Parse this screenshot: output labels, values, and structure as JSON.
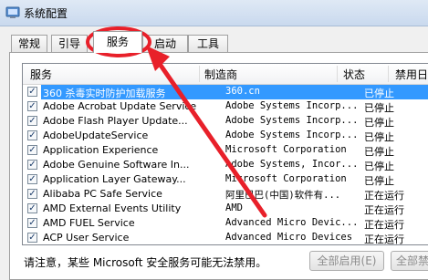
{
  "window": {
    "title": "系统配置"
  },
  "tabs": [
    "常规",
    "引导",
    "服务",
    "启动",
    "工具"
  ],
  "active_tab": "服务",
  "columns": {
    "service": "服务",
    "manufacturer": "制造商",
    "status": "状态",
    "date_disabled": "禁用日"
  },
  "services": [
    {
      "name": "360 杀毒实时防护加载服务",
      "manufacturer": "360.cn",
      "status": "已停止",
      "checked": true,
      "selected": true
    },
    {
      "name": "Adobe Acrobat Update Service",
      "manufacturer": "Adobe Systems Incorp...",
      "status": "已停止",
      "checked": true
    },
    {
      "name": "Adobe Flash Player Update...",
      "manufacturer": "Adobe Systems Incorp...",
      "status": "已停止",
      "checked": true
    },
    {
      "name": "AdobeUpdateService",
      "manufacturer": "Adobe Systems Incorp...",
      "status": "已停止",
      "checked": true
    },
    {
      "name": "Application Experience",
      "manufacturer": "Microsoft Corporation",
      "status": "已停止",
      "checked": true
    },
    {
      "name": "Adobe Genuine Software In...",
      "manufacturer": "Adobe Systems, Incor...",
      "status": "已停止",
      "checked": true
    },
    {
      "name": "Application Layer Gateway...",
      "manufacturer": "Microsoft Corporation",
      "status": "已停止",
      "checked": true
    },
    {
      "name": "Alibaba PC Safe Service",
      "manufacturer": "阿里巴巴(中国)软件有...",
      "status": "正在运行",
      "checked": true
    },
    {
      "name": "AMD External Events Utility",
      "manufacturer": "AMD",
      "status": "正在运行",
      "checked": true
    },
    {
      "name": "AMD FUEL Service",
      "manufacturer": "Advanced Micro Devic...",
      "status": "正在运行",
      "checked": true
    },
    {
      "name": "ACP User Service",
      "manufacturer": "Advanced Micro Devices",
      "status": "正在运行",
      "checked": true
    }
  ],
  "footer": {
    "note": "请注意，某些 Microsoft 安全服务可能无法禁用。",
    "enable_all": "全部启用(E)",
    "disable_all": "全部禁用"
  },
  "colors": {
    "selection": "#3399ff",
    "annotation": "#e8202a"
  }
}
